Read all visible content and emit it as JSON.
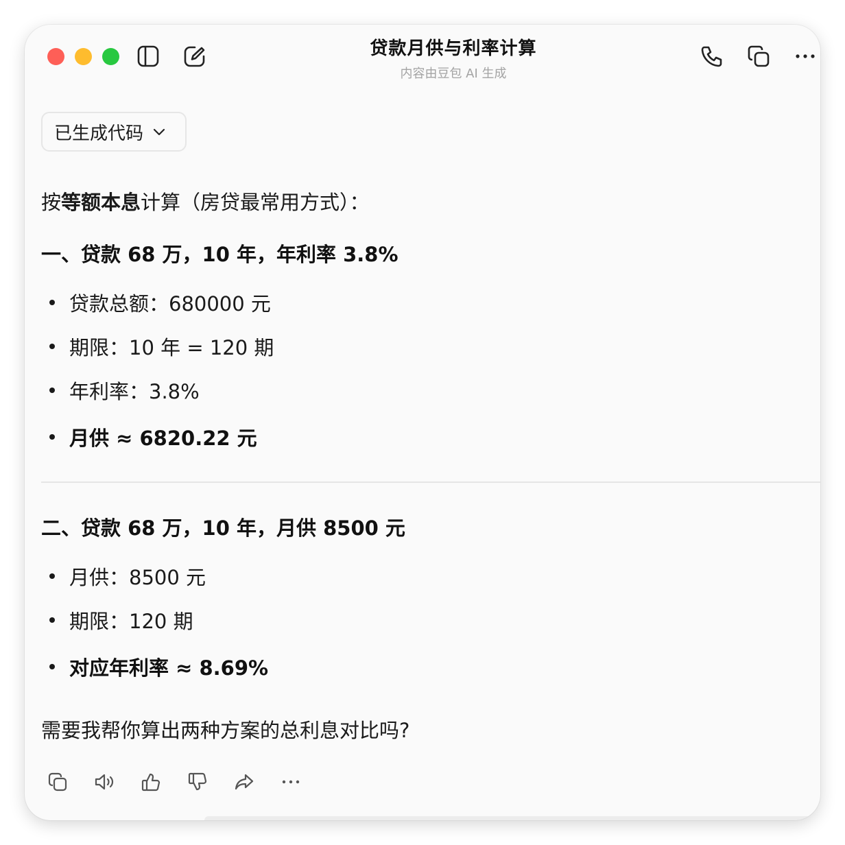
{
  "window": {
    "title": "贷款月供与利率计算",
    "subtitle": "内容由豆包 AI 生成",
    "traffic_colors": {
      "close": "#fe5f57",
      "minimize": "#febc2e",
      "zoom": "#28c840"
    }
  },
  "toolbar": {
    "left_icons": [
      "sidebar-toggle-icon",
      "new-chat-icon"
    ],
    "right_icons": [
      "phone-icon",
      "copy-window-icon",
      "more-icon"
    ]
  },
  "code_chip": {
    "label": "已生成代码",
    "icon": "chevron-down-icon"
  },
  "message": {
    "intro": {
      "before": "按",
      "bold": "等额本息",
      "after": "计算（房贷最常用方式）："
    },
    "section1": {
      "heading": "一、贷款 68 万，10 年，年利率 3.8%",
      "items": [
        "贷款总额：680000 元",
        "期限：10 年 = 120 期",
        "年利率：3.8%"
      ],
      "result": "月供 ≈ 6820.22 元"
    },
    "section2": {
      "heading": "二、贷款 68 万，10 年，月供 8500 元",
      "items": [
        "月供：8500 元",
        "期限：120 期"
      ],
      "result": "对应年利率 ≈ 8.69%"
    },
    "closing": "需要我帮你算出两种方案的总利息对比吗?"
  },
  "actions": [
    "copy-icon",
    "speaker-icon",
    "thumbs-up-icon",
    "thumbs-down-icon",
    "share-icon",
    "more-icon"
  ]
}
